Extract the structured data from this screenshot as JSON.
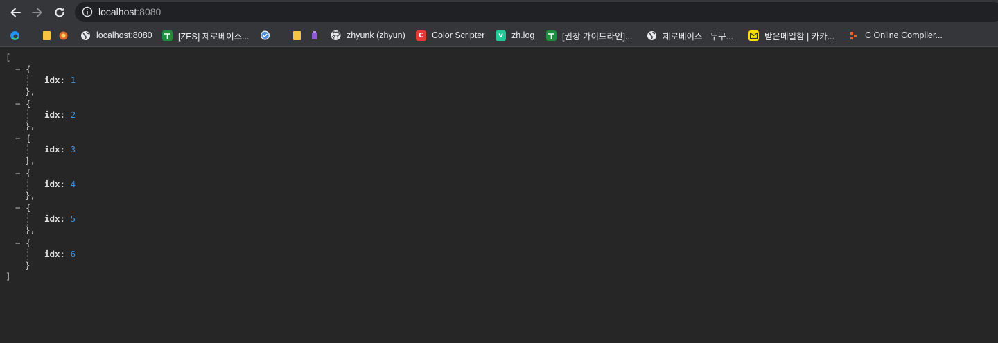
{
  "toolbar": {
    "url_host": "localhost",
    "url_port": ":8080",
    "back_icon": "arrow-left-icon",
    "forward_icon": "arrow-right-icon",
    "reload_icon": "reload-icon",
    "info_icon": "info-icon"
  },
  "bookmarks": [
    {
      "label": "",
      "icon": "edge-icon",
      "color": "#1e90ff"
    },
    {
      "label": "",
      "icon": "folder-icon",
      "color": "#f6c343"
    },
    {
      "label": "",
      "icon": "extension-icon",
      "color": "#e56a2d"
    },
    {
      "label": "localhost:8080",
      "icon": "globe-icon",
      "color": "#e8eaed"
    },
    {
      "label": "[ZES] 제로베이스...",
      "icon": "sheet-icon",
      "color": "#1e8e3e"
    },
    {
      "label": "",
      "icon": "check-icon",
      "color": "#4a90e2"
    },
    {
      "label": "",
      "icon": "folder-icon",
      "color": "#f6c343"
    },
    {
      "label": "",
      "icon": "extension-icon",
      "color": "#8e5bd0"
    },
    {
      "label": "zhyunk (zhyun)",
      "icon": "github-icon",
      "color": "#e8eaed"
    },
    {
      "label": "Color Scripter",
      "icon": "c-icon",
      "color": "#e53935"
    },
    {
      "label": "zh.log",
      "icon": "velog-icon",
      "color": "#20c997"
    },
    {
      "label": "[권장 가이드라인]...",
      "icon": "sheet-icon",
      "color": "#1e8e3e"
    },
    {
      "label": "제로베이스 - 누구...",
      "icon": "globe-icon",
      "color": "#e8eaed"
    },
    {
      "label": "받은메일함 | 카카...",
      "icon": "mail-icon",
      "color": "#f9e000"
    },
    {
      "label": "C Online Compiler...",
      "icon": "compiler-icon",
      "color": "#e8632c"
    }
  ],
  "json": {
    "open_bracket": "[",
    "close_bracket": "]",
    "toggle": "−",
    "open_brace": "{",
    "close_brace": "},",
    "close_brace_last": "}",
    "items": [
      {
        "key": "idx",
        "value": "1"
      },
      {
        "key": "idx",
        "value": "2"
      },
      {
        "key": "idx",
        "value": "3"
      },
      {
        "key": "idx",
        "value": "4"
      },
      {
        "key": "idx",
        "value": "5"
      },
      {
        "key": "idx",
        "value": "6"
      }
    ]
  }
}
